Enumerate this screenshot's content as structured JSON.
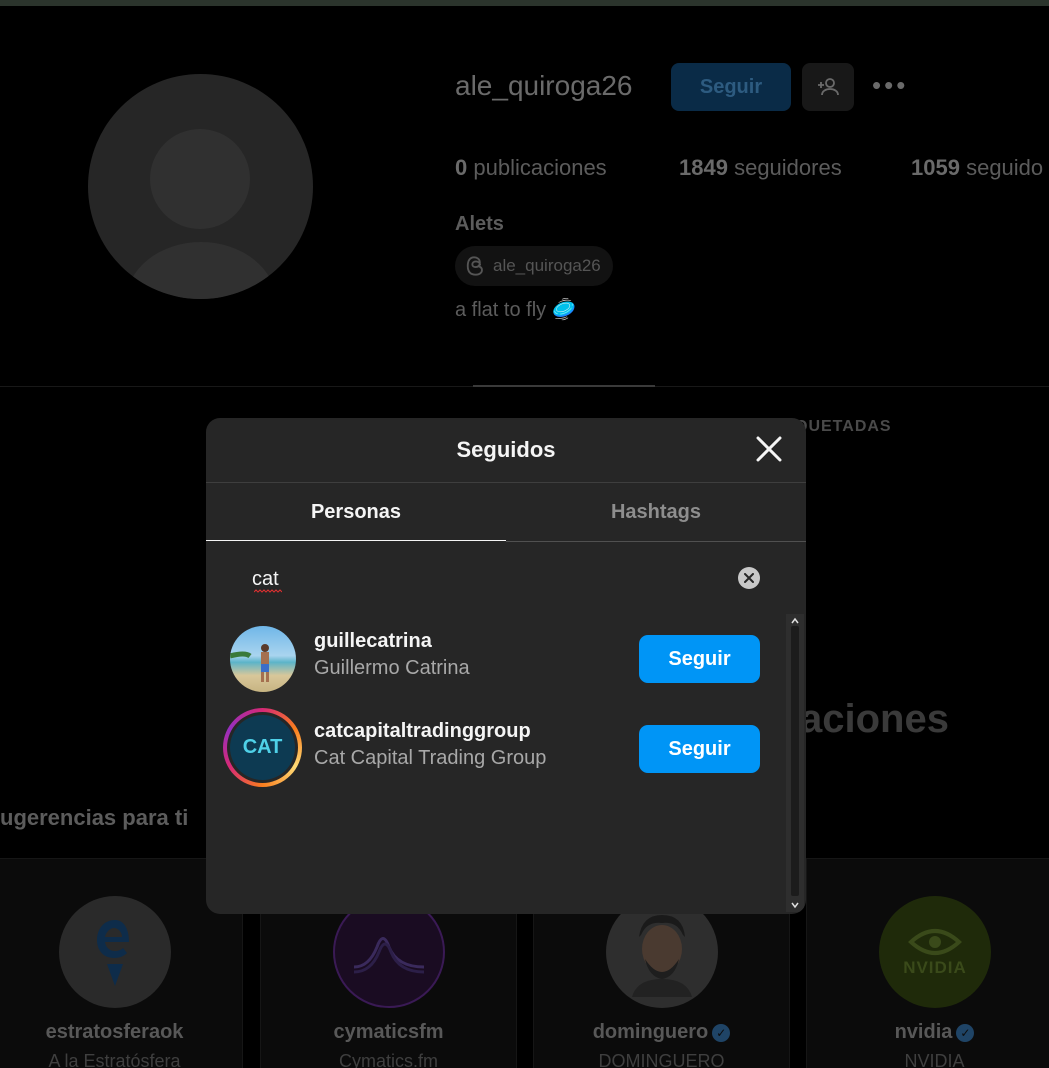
{
  "profile": {
    "username": "ale_quiroga26",
    "follow_label": "Seguir",
    "more_label": "•••",
    "stats": {
      "posts_count": "0",
      "posts_label": "publicaciones",
      "followers_count": "1849",
      "followers_label": "seguidores",
      "following_count": "1059",
      "following_label": "seguido"
    },
    "full_name": "Alets",
    "threads_handle": "ale_quiroga26",
    "bio": "a flat to fly 🥏"
  },
  "background": {
    "tab_tagged": "QUETADAS",
    "big_heading": "aciones",
    "suggestions_title": "ugerencias para ti",
    "suggestions": [
      {
        "username": "estratosferaok",
        "subtitle": "A la Estratósfera",
        "verified": false
      },
      {
        "username": "cymaticsfm",
        "subtitle": "Cymatics.fm",
        "verified": false
      },
      {
        "username": "dominguero",
        "subtitle": "DOMINGUERO",
        "verified": true
      },
      {
        "username": "nvidia",
        "subtitle": "NVIDIA",
        "verified": true,
        "logo_text": "NVIDIA"
      }
    ]
  },
  "modal": {
    "title": "Seguidos",
    "tabs": [
      {
        "label": "Personas",
        "active": true
      },
      {
        "label": "Hashtags",
        "active": false
      }
    ],
    "search": {
      "value": "cat"
    },
    "results": [
      {
        "username": "guillecatrina",
        "full_name": "Guillermo Catrina",
        "button": "Seguir"
      },
      {
        "username": "catcapitaltradinggroup",
        "full_name": "Cat Capital Trading Group",
        "button": "Seguir",
        "avatar_text": "CAT"
      }
    ]
  },
  "colors": {
    "accent": "#0095f6",
    "modal_bg": "#262626",
    "page_bg": "#000000"
  }
}
